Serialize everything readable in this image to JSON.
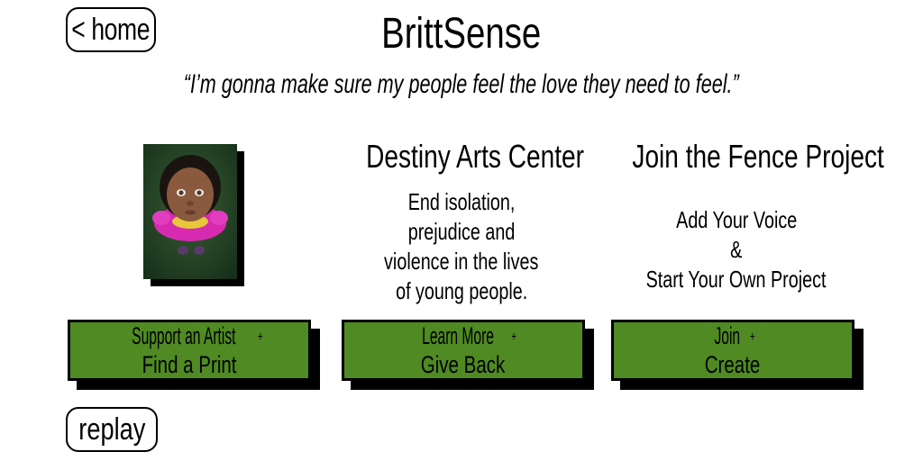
{
  "nav": {
    "home_label": "< home",
    "replay_label": "replay"
  },
  "header": {
    "title": "BrittSense",
    "quote": "“I’m gonna make sure my people feel the love they need to feel.”"
  },
  "columns": [
    {
      "heading": "",
      "description": [],
      "button": {
        "line1": "Support an Artist",
        "line2": "Find a Print",
        "plus": "+"
      }
    },
    {
      "heading": "Destiny Arts Center",
      "description": [
        "End isolation,",
        "prejudice and",
        "violence in the lives",
        "of young people."
      ],
      "button": {
        "line1": "Learn More",
        "line2": "Give Back",
        "plus": "+"
      }
    },
    {
      "heading": "Join the Fence Project",
      "description": [
        "Add Your Voice",
        "&",
        "Start Your Own Project"
      ],
      "button": {
        "line1": "Join",
        "line2": "Create",
        "plus": "+"
      }
    }
  ],
  "colors": {
    "button_green": "#4f8a23",
    "shadow": "#000000",
    "background": "#ffffff"
  }
}
